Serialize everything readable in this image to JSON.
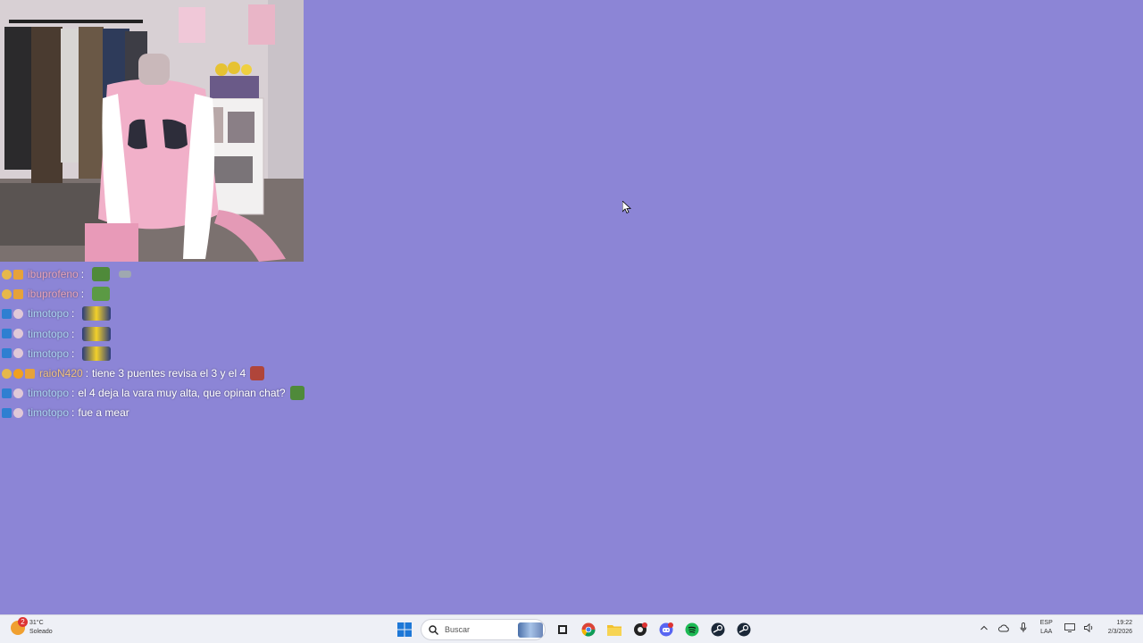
{
  "chat": {
    "messages": [
      {
        "user": "ibuprofeno",
        "user_color": "#e8a3b8",
        "text": "",
        "badges": [
          "sub",
          "gift"
        ],
        "emotes": [
          "pepe-green",
          "small-grey"
        ]
      },
      {
        "user": "ibuprofeno",
        "user_color": "#e8a3b8",
        "text": "",
        "badges": [
          "sub",
          "gift"
        ],
        "emotes": [
          "pepe-face"
        ]
      },
      {
        "user": "timotopo",
        "user_color": "#a9d4f0",
        "text": "",
        "badges": [
          "blue",
          "sub"
        ],
        "emotes": [
          "kermit-wide"
        ]
      },
      {
        "user": "timotopo",
        "user_color": "#a9d4f0",
        "text": "",
        "badges": [
          "blue",
          "sub"
        ],
        "emotes": [
          "kermit-wide"
        ]
      },
      {
        "user": "timotopo",
        "user_color": "#a9d4f0",
        "text": "",
        "badges": [
          "blue",
          "sub"
        ],
        "emotes": [
          "kermit-wide"
        ]
      },
      {
        "user": "raioN420",
        "user_color": "#f0c080",
        "text": "tiene 3 puentes revisa el 3 y el 4",
        "badges": [
          "sub",
          "bits",
          "gift"
        ],
        "emotes": [
          "angry-face"
        ]
      },
      {
        "user": "timotopo",
        "user_color": "#a9d4f0",
        "text": "el 4 deja la vara muy alta, que opinan chat?",
        "badges": [
          "blue",
          "sub"
        ],
        "emotes": [
          "pepe-green"
        ]
      },
      {
        "user": "timotopo",
        "user_color": "#a9d4f0",
        "text": "fue a mear",
        "badges": [
          "blue",
          "sub"
        ],
        "emotes": []
      }
    ],
    "separator": ":"
  },
  "taskbar": {
    "weather_temp": "31°C",
    "weather_desc": "Soleado",
    "weather_badge": "2",
    "search_placeholder": "Buscar",
    "lang_top": "ESP",
    "lang_bottom": "LAA",
    "time": "19:22",
    "date": "2/3/2026"
  },
  "colors": {
    "background": "#8c85d6",
    "accent_blue": "#1e78d7"
  }
}
